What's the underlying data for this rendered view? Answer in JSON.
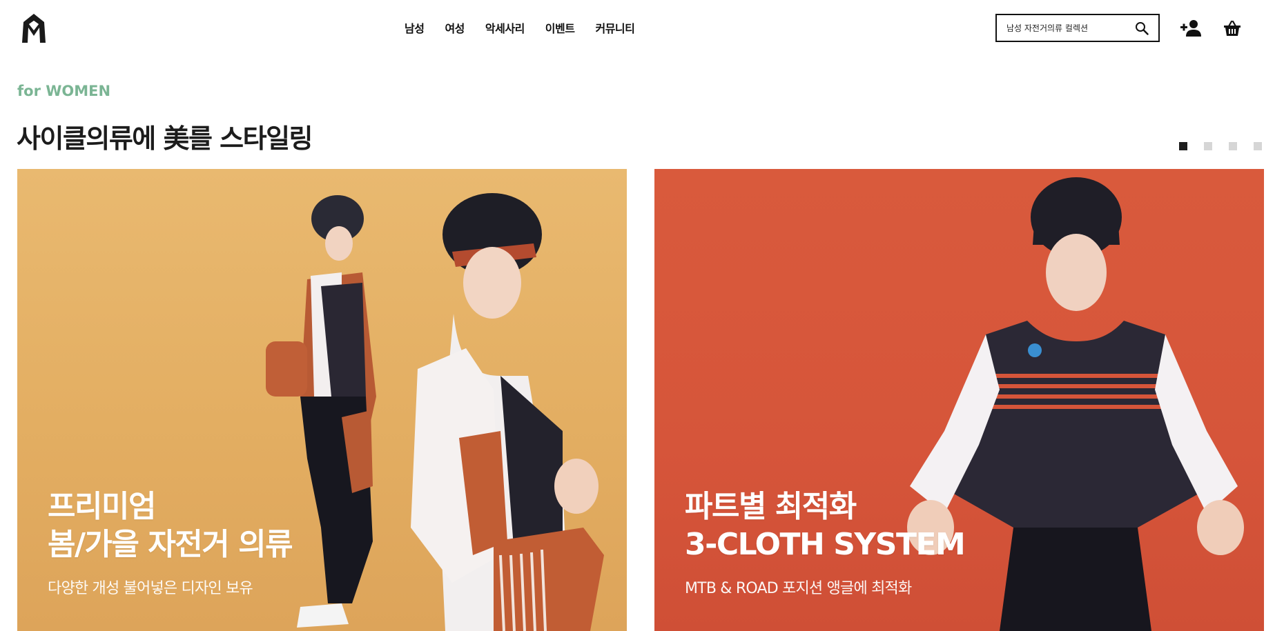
{
  "header": {
    "logo_icon": "brand-logo-icon",
    "nav": [
      {
        "label": "남성"
      },
      {
        "label": "여성"
      },
      {
        "label": "악세사리"
      },
      {
        "label": "이벤트"
      },
      {
        "label": "커뮤니티"
      }
    ],
    "search": {
      "placeholder": "남성 자전거의류 컬렉션",
      "icon": "search-icon"
    },
    "user_icon": "add-user-icon",
    "cart_icon": "basket-icon"
  },
  "section": {
    "eyebrow": "for WOMEN",
    "title": "사이클의류에 美를 스타일링",
    "pager": {
      "count": 4,
      "active_index": 0
    }
  },
  "banners": [
    {
      "title_line1": "프리미엄",
      "title_line2": "봄/가을 자전거 의류",
      "subtitle": "다양한 개성 불어넣은 디자인 보유",
      "background": "#e5b066"
    },
    {
      "title_line1": "파트별 최적화",
      "title_line2": "3-CLOTH SYSTEM",
      "subtitle": "MTB & ROAD 포지션 앵글에 최적화",
      "background": "#d6553a"
    }
  ],
  "colors": {
    "accent_green": "#7bb594",
    "text_dark": "#1c1c1c",
    "pager_active": "#1e1e1e",
    "pager_inactive": "#d6d6d6"
  }
}
